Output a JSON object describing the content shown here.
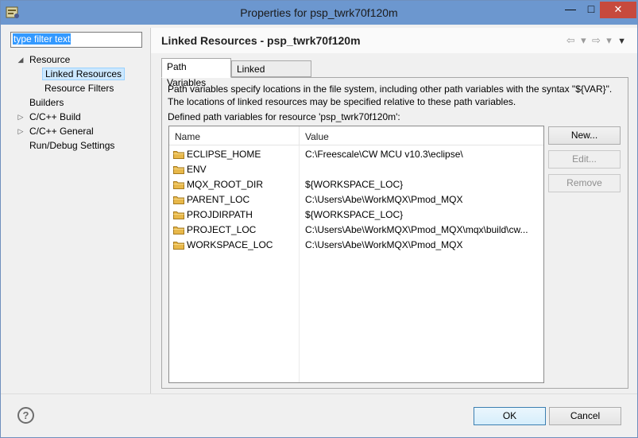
{
  "window": {
    "title": "Properties for psp_twrk70f120m",
    "min_glyph": "—",
    "max_glyph": "□",
    "close_glyph": "✕"
  },
  "filter": {
    "value": "type filter text"
  },
  "tree": [
    {
      "label": "Resource",
      "twisty": "◢"
    },
    {
      "label": "Linked Resources",
      "selected": true
    },
    {
      "label": "Resource Filters"
    },
    {
      "label": "Builders"
    },
    {
      "label": "C/C++ Build",
      "twisty": "▷"
    },
    {
      "label": "C/C++ General",
      "twisty": "▷"
    },
    {
      "label": "Run/Debug Settings"
    }
  ],
  "header": {
    "title": "Linked Resources - psp_twrk70f120m",
    "back_icon": "⇦",
    "forward_icon": "⇨",
    "dropdown_icon": "▾",
    "menu_icon": "▼"
  },
  "tabs": [
    {
      "label": "Path Variables",
      "active": true
    },
    {
      "label": "Linked Resources",
      "active": false
    }
  ],
  "description": {
    "line1": "Path variables specify locations in the file system, including other path variables with the syntax \"${VAR}\".",
    "line2": "The locations of linked resources may be specified relative to these path variables."
  },
  "defined_label": "Defined path variables for resource 'psp_twrk70f120m':",
  "table": {
    "columns": [
      "Name",
      "Value"
    ],
    "rows": [
      {
        "name": "ECLIPSE_HOME",
        "value": "C:\\Freescale\\CW MCU v10.3\\eclipse\\"
      },
      {
        "name": "ENV",
        "value": ""
      },
      {
        "name": "MQX_ROOT_DIR",
        "value": "${WORKSPACE_LOC}"
      },
      {
        "name": "PARENT_LOC",
        "value": "C:\\Users\\Abe\\WorkMQX\\Pmod_MQX"
      },
      {
        "name": "PROJDIRPATH",
        "value": "${WORKSPACE_LOC}"
      },
      {
        "name": "PROJECT_LOC",
        "value": "C:\\Users\\Abe\\WorkMQX\\Pmod_MQX\\mqx\\build\\cw..."
      },
      {
        "name": "WORKSPACE_LOC",
        "value": "C:\\Users\\Abe\\WorkMQX\\Pmod_MQX"
      }
    ]
  },
  "buttons": {
    "new": "New...",
    "edit": "Edit...",
    "remove": "Remove",
    "ok": "OK",
    "cancel": "Cancel",
    "help": "?"
  },
  "colors": {
    "titlebar": "#6c97cf",
    "close": "#c74a3d",
    "selection": "#cce8ff",
    "folder": "#e8b84a"
  }
}
